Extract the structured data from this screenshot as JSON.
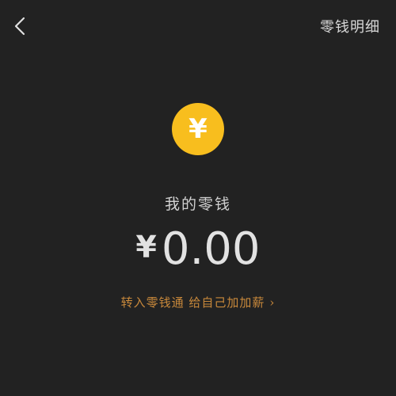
{
  "header": {
    "back_icon": "chevron-left-icon",
    "details_link": "零钱明细"
  },
  "balance": {
    "coin_icon": "yuan-coin-icon",
    "coin_symbol": "¥",
    "coin_color": "#F8BE1E",
    "label": "我的零钱",
    "currency_symbol": "¥",
    "amount": "0.00"
  },
  "promo": {
    "text": "转入零钱通 给自己加加薪",
    "chevron": "›",
    "color": "#C9893B"
  },
  "colors": {
    "background": "#222222"
  }
}
